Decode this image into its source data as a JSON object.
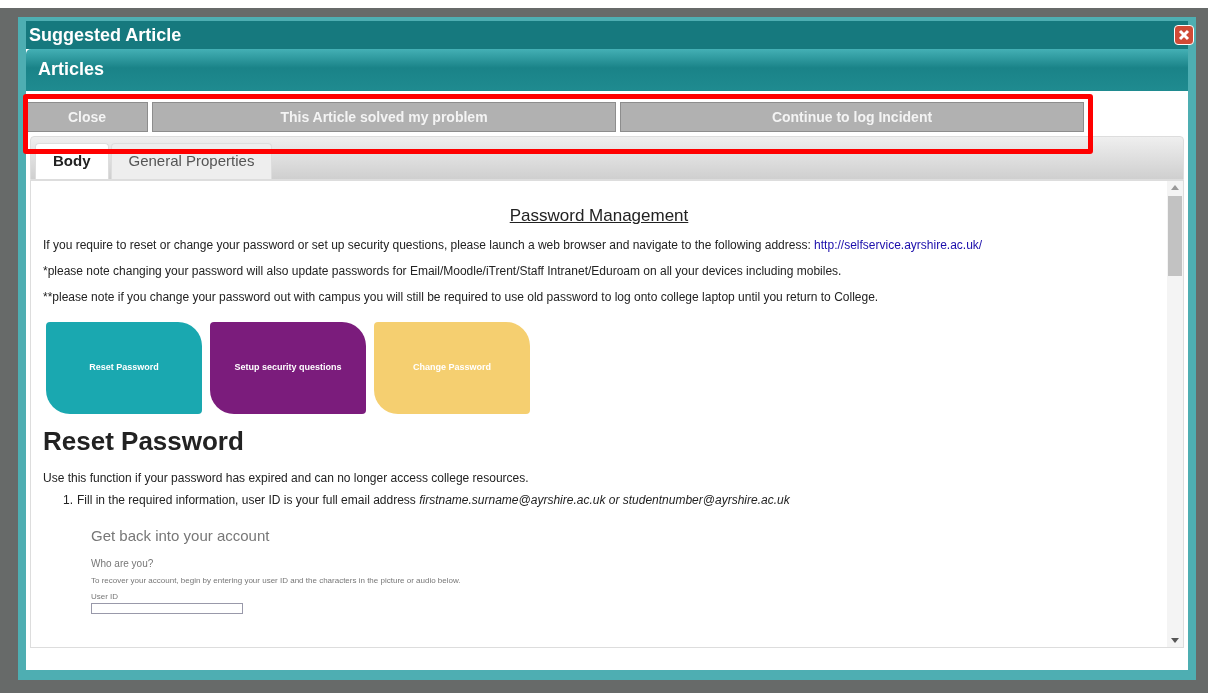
{
  "window": {
    "title": "Suggested Article"
  },
  "panel": {
    "title": "Articles"
  },
  "toolbar": {
    "highlighted": true,
    "buttons": [
      "Close",
      "This Article solved my problem",
      "Continue to log Incident"
    ]
  },
  "tabs": [
    {
      "label": "Body",
      "selected": true
    },
    {
      "label": "General Properties",
      "selected": false
    }
  ],
  "article": {
    "heading": "Password Management",
    "intro": "If you require to reset or change your password or set up security questions, please launch a web browser and navigate to the following address:",
    "link": "http://selfservice.ayrshire.ac.uk/",
    "notes": [
      "*please note changing your password will also update passwords for Email/Moodle/iTrent/Staff Intranet/Eduroam on all your devices including mobiles.",
      "**please note if you change your password out with campus you will still be required to use old password to log onto college laptop until you return to College."
    ],
    "tiles": [
      {
        "label": "Reset Password",
        "color": "#1aa8b0"
      },
      {
        "label": "Setup security questions",
        "color": "#7b1c7c"
      },
      {
        "label": "Change Password",
        "color": "#f5cf70"
      }
    ],
    "section_title": "Reset Password",
    "section_text": "Use this function if your password has expired and can no longer access college resources.",
    "steps": [
      {
        "number": "1.",
        "text": "Fill in the required information, user ID is your full email address *firstname.surname@ayrshire.ac.uk or studentnumber@ayrshire.ac.uk*"
      }
    ],
    "embedded": {
      "title": "Get back into your account",
      "subtitle": "Who are you?",
      "text": "To recover your account, begin by entering your user ID and the characters in the picture or audio below.",
      "field_label": "User ID"
    }
  }
}
